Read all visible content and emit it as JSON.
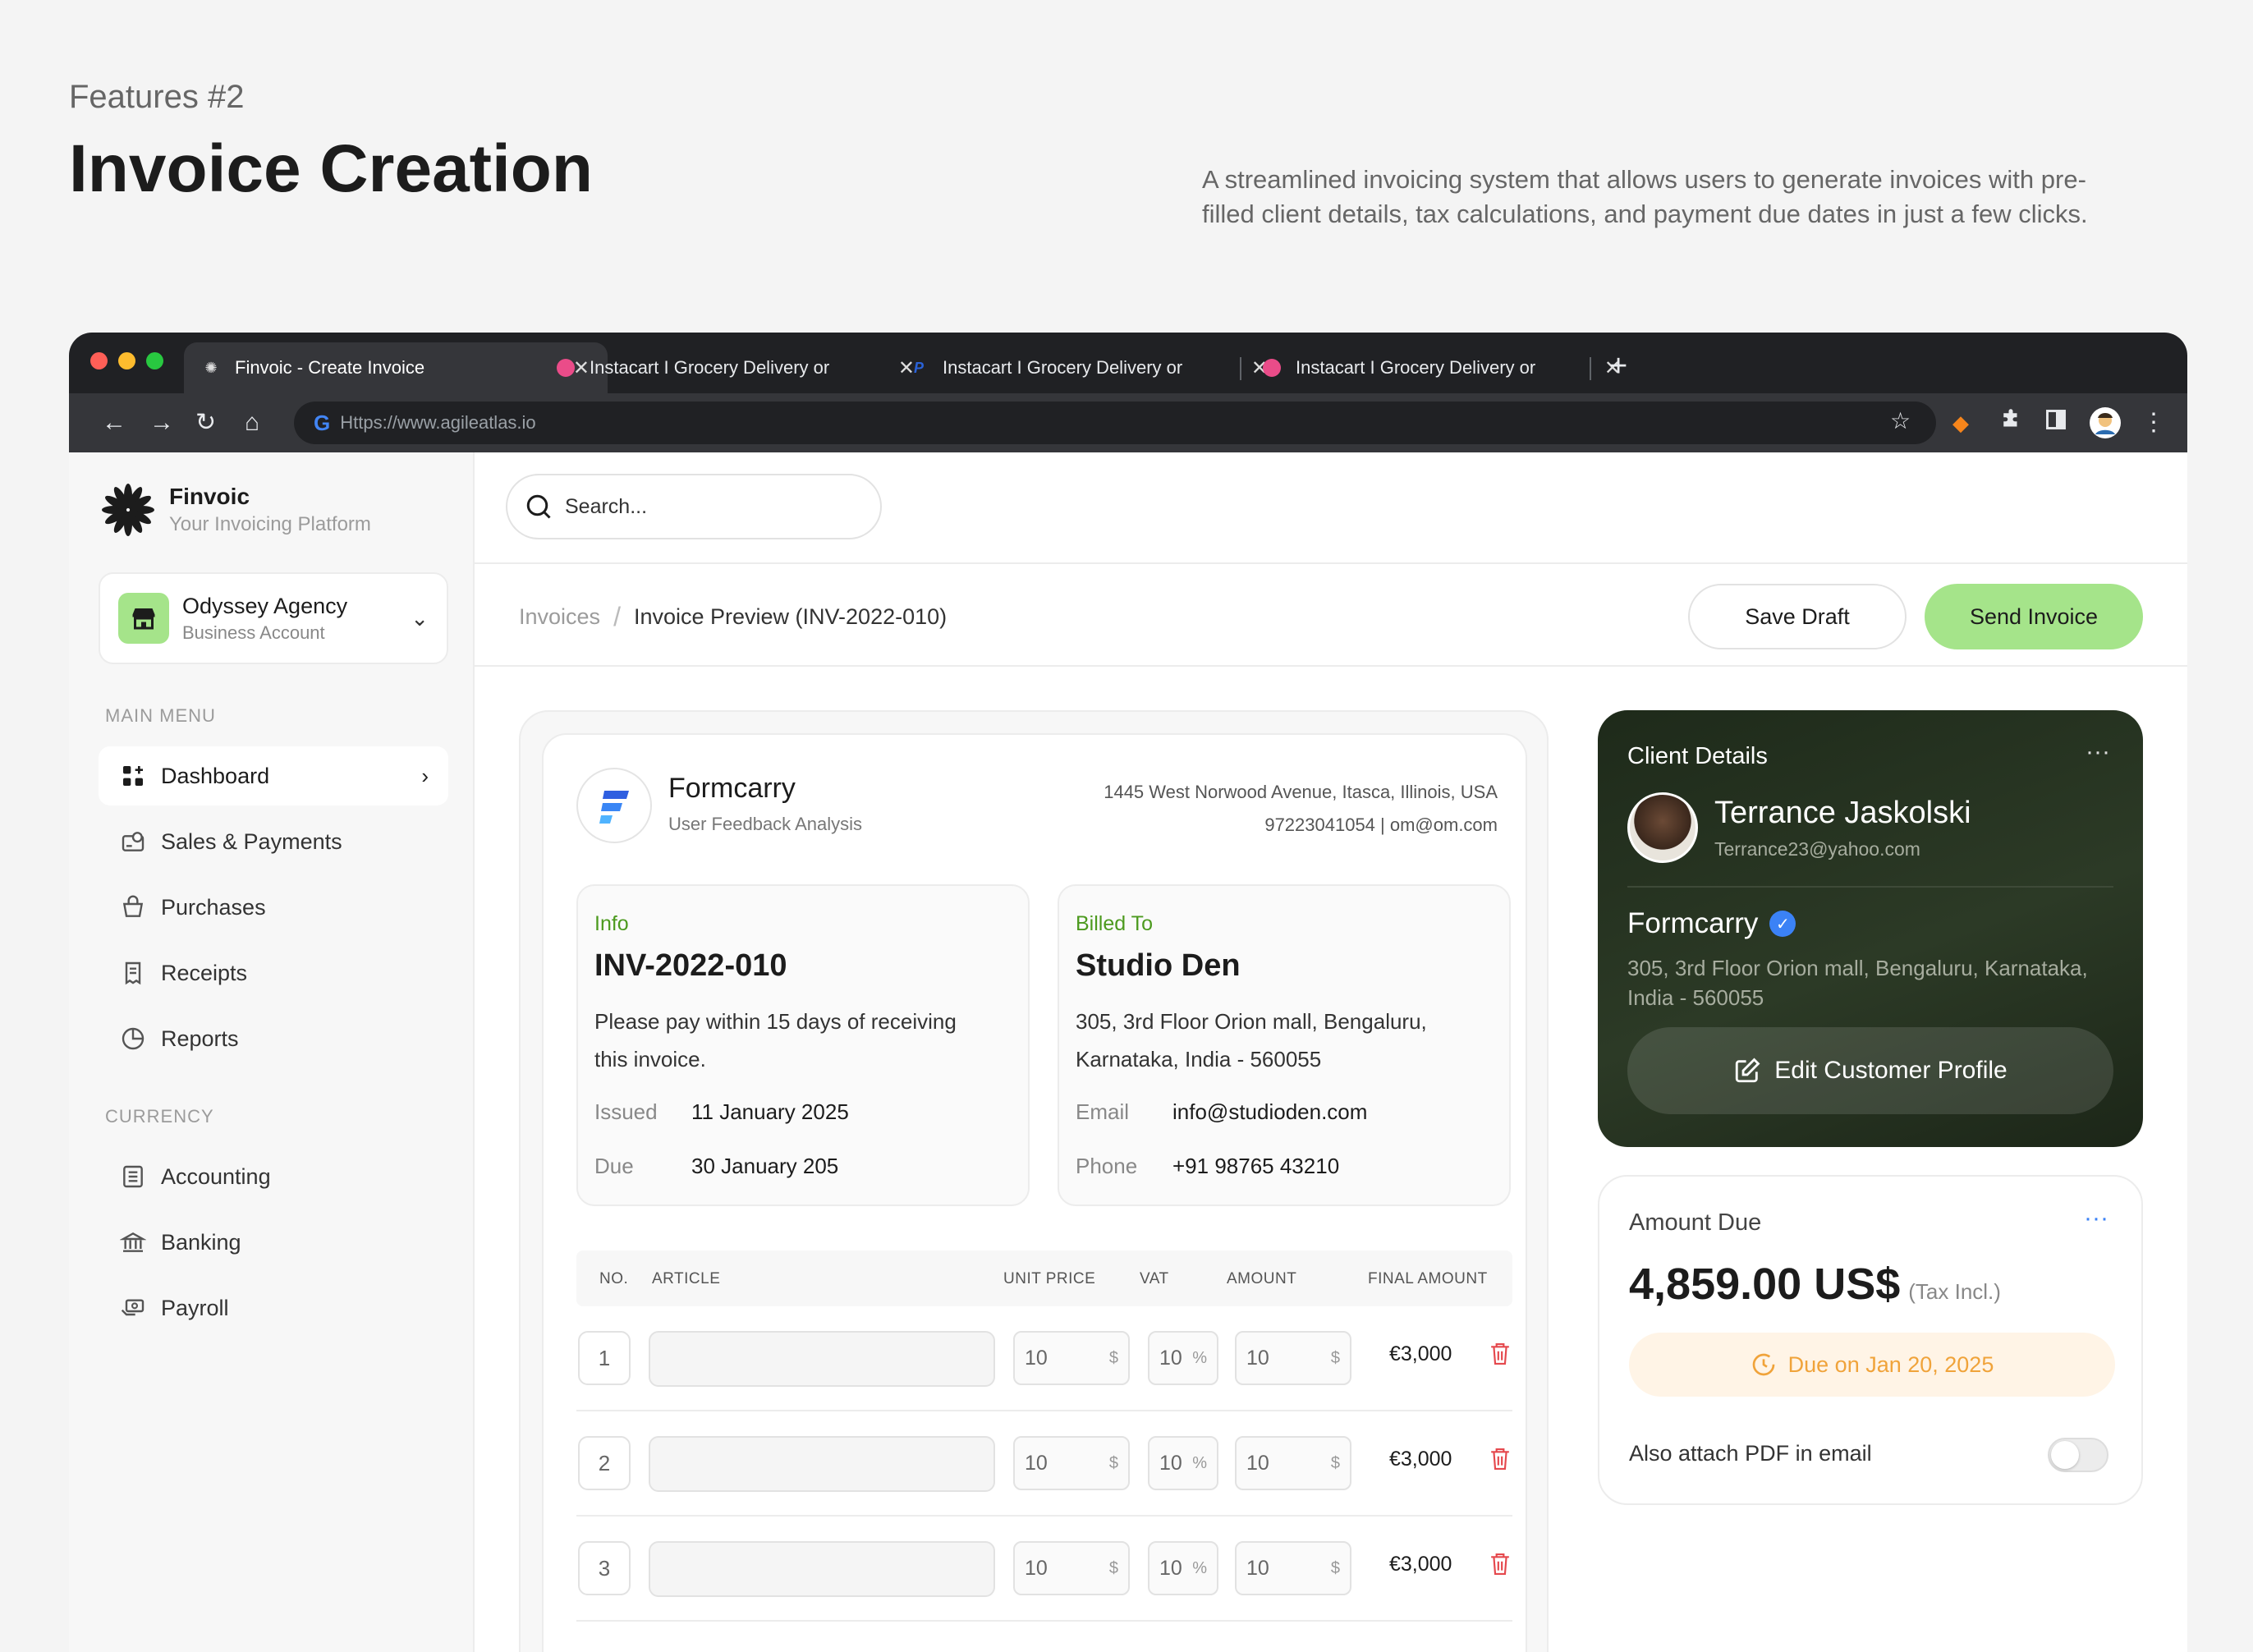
{
  "header": {
    "eyebrow": "Features #2",
    "title": "Invoice Creation",
    "description": "A streamlined invoicing system that allows users to generate invoices with pre-filled client details, tax calculations, and payment due dates in just a few clicks."
  },
  "browser": {
    "tabs": [
      {
        "title": "Finvoic - Create Invoice",
        "active": true
      },
      {
        "title": "Instacart I Grocery Delivery or",
        "active": false
      },
      {
        "title": "Instacart I Grocery Delivery or",
        "active": false
      },
      {
        "title": "Instacart I Grocery Delivery or",
        "active": false
      }
    ],
    "url": "Https://www.agileatlas.io"
  },
  "sidebar": {
    "brand_name": "Finvoic",
    "brand_sub": "Your Invoicing Platform",
    "account_name": "Odyssey Agency",
    "account_type": "Business Account",
    "main_menu_label": "MAIN MENU",
    "main_items": [
      "Dashboard",
      "Sales & Payments",
      "Purchases",
      "Receipts",
      "Reports"
    ],
    "currency_label": "CURRENCY",
    "currency_items": [
      "Accounting",
      "Banking",
      "Payroll"
    ]
  },
  "search": {
    "placeholder": "Search..."
  },
  "breadcrumb": {
    "root": "Invoices",
    "current": "Invoice Preview (INV-2022-010)"
  },
  "actions": {
    "save_draft": "Save Draft",
    "send_invoice": "Send Invoice"
  },
  "company": {
    "name": "Formcarry",
    "subtitle": "User Feedback Analysis",
    "address": "1445 West Norwood Avenue, Itasca, Illinois, USA",
    "contact": "97223041054 | om@om.com"
  },
  "info": {
    "label": "Info",
    "number": "INV-2022-010",
    "note": "Please pay within 15 days of receiving this invoice.",
    "issued_label": "Issued",
    "issued": "11 January 2025",
    "due_label": "Due",
    "due": "30 January 205"
  },
  "billed": {
    "label": "Billed To",
    "name": "Studio Den",
    "address": "305, 3rd Floor Orion mall, Bengaluru, Karnataka, India - 560055",
    "email_label": "Email",
    "email": "info@studioden.com",
    "phone_label": "Phone",
    "phone": "+91 98765 43210"
  },
  "table": {
    "headers": [
      "NO.",
      "ARTICLE",
      "UNIT PRICE",
      "VAT",
      "AMOUNT",
      "FINAL AMOUNT"
    ],
    "rows": [
      {
        "no": "1",
        "unit_price": "10",
        "unit_sym": "$",
        "vat": "10",
        "vat_sym": "%",
        "amount": "10",
        "amount_sym": "$",
        "final": "€3,000"
      },
      {
        "no": "2",
        "unit_price": "10",
        "unit_sym": "$",
        "vat": "10",
        "vat_sym": "%",
        "amount": "10",
        "amount_sym": "$",
        "final": "€3,000"
      },
      {
        "no": "3",
        "unit_price": "10",
        "unit_sym": "$",
        "vat": "10",
        "vat_sym": "%",
        "amount": "10",
        "amount_sym": "$",
        "final": "€3,000"
      }
    ]
  },
  "client": {
    "title": "Client Details",
    "name": "Terrance Jaskolski",
    "email": "Terrance23@yahoo.com",
    "company": "Formcarry",
    "address": "305, 3rd Floor Orion mall, Bengaluru, Karnataka, India - 560055",
    "edit_label": "Edit Customer Profile"
  },
  "amount": {
    "title": "Amount Due",
    "value": "4,859.00 US$",
    "tax_note": "(Tax Incl.)",
    "due_label": "Due on Jan 20, 2025",
    "attach_label": "Also attach PDF in email",
    "attach_on": false
  },
  "colors": {
    "accent_green": "#a5e48a",
    "info_green": "#4c9a1e",
    "due_orange": "#f0a33a",
    "danger_red": "#e5484d",
    "verified_blue": "#3b82f6"
  }
}
